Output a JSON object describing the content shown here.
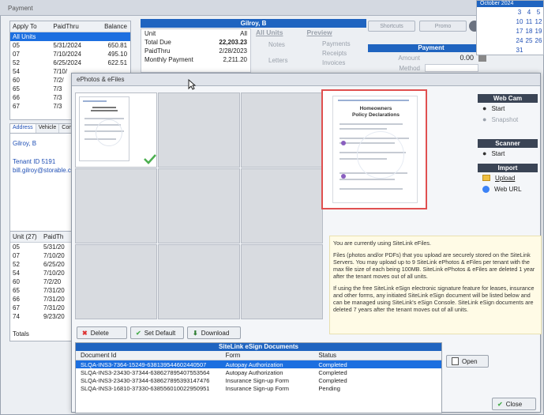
{
  "background": {
    "window_title": "Payment",
    "tenant_name": "Gilroy, B",
    "apply_grid": {
      "headers": [
        "Apply To",
        "PaidThru",
        "Balance"
      ],
      "rows": [
        {
          "unit": "All Units",
          "paid": "",
          "bal": ""
        },
        {
          "unit": "05",
          "paid": "5/31/2024",
          "bal": "650.81"
        },
        {
          "unit": "07",
          "paid": "7/10/2024",
          "bal": "495.10"
        },
        {
          "unit": "52",
          "paid": "6/25/2024",
          "bal": "622.51"
        },
        {
          "unit": "54",
          "paid": "7/10/",
          "bal": ""
        },
        {
          "unit": "60",
          "paid": "7/2/",
          "bal": ""
        },
        {
          "unit": "65",
          "paid": "7/3",
          "bal": ""
        },
        {
          "unit": "66",
          "paid": "7/3",
          "bal": ""
        },
        {
          "unit": "67",
          "paid": "7/3",
          "bal": ""
        }
      ]
    },
    "unit_info": {
      "unit_label": "Unit",
      "unit_value": "All",
      "total_due_label": "Total Due",
      "total_due_value": "22,203.23",
      "paid_thru_label": "PaidThru",
      "paid_thru_value": "2/28/2023",
      "monthly_label": "Monthly Payment",
      "monthly_value": "2,211.20"
    },
    "preview_panel": {
      "all_units": "All Units",
      "preview": "Preview",
      "notes": "Notes",
      "letters": "Letters",
      "payments": "Payments",
      "receipts": "Receipts",
      "invoices": "Invoices"
    },
    "top_buttons": {
      "shortcuts": "Shortcuts",
      "promo": "Promo"
    },
    "payment": {
      "title": "Payment",
      "amount_label": "Amount",
      "amount_value": "0.00",
      "method_label": "Method"
    },
    "calendar": {
      "title": "October 2024",
      "rows": [
        [
          "3",
          "4",
          "5"
        ],
        [
          "10",
          "11",
          "12"
        ],
        [
          "17",
          "18",
          "19"
        ],
        [
          "24",
          "25",
          "26"
        ],
        [
          "31",
          "",
          ""
        ]
      ]
    },
    "tenant_tabs": [
      "Address",
      "Vehicle",
      "Conta"
    ],
    "tenant_info": {
      "name": "Gilroy, B",
      "tenant_id": "Tenant ID  5191",
      "email": "bill.gilroy@storable.c"
    },
    "unit_grid": {
      "headers": [
        "Unit (27)",
        "PaidTh"
      ],
      "rows": [
        {
          "unit": "05",
          "paid": "5/31/20"
        },
        {
          "unit": "07",
          "paid": "7/10/20"
        },
        {
          "unit": "52",
          "paid": "6/25/20"
        },
        {
          "unit": "54",
          "paid": "7/10/20"
        },
        {
          "unit": "60",
          "paid": "7/2/20"
        },
        {
          "unit": "65",
          "paid": "7/31/20"
        },
        {
          "unit": "66",
          "paid": "7/31/20"
        },
        {
          "unit": "67",
          "paid": "7/31/20"
        },
        {
          "unit": "74",
          "paid": "9/23/20"
        }
      ],
      "totals_label": "Totals"
    }
  },
  "dialog": {
    "title": "ePhotos & eFiles",
    "thumbnail": {
      "title_line1": "Homeowners",
      "title_line2": "Policy Declarations"
    },
    "webcam": {
      "title": "Web Cam",
      "start": "Start",
      "snapshot": "Snapshot"
    },
    "scanner": {
      "title": "Scanner",
      "start": "Start"
    },
    "import": {
      "title": "Import",
      "upload": "Upload",
      "web_url": "Web URL"
    },
    "info_paragraphs": [
      "You are currently using SiteLink eFiles.",
      "Files (photos and/or PDFs) that you upload are securely stored on the SiteLink Servers. You may upload up to 9 SiteLink ePhotos & eFiles per tenant with the max file size of each being 100MB. SiteLink ePhotos & eFiles are deleted 1 year after the tenant moves out of all units.",
      "If using the free SiteLink eSign electronic signature feature for leases, insurance and other forms, any initiated SiteLink eSign document will be listed below and can be managed using SiteLink's eSign Console. SiteLink eSign documents are deleted 7 years after the tenant moves out of all units."
    ],
    "buttons": {
      "delete": "Delete",
      "set_default": "Set Default",
      "download": "Download",
      "open": "Open",
      "close": "Close"
    },
    "esign": {
      "title": "SiteLink eSign Documents",
      "headers": [
        "Document Id",
        "Form",
        "Status"
      ],
      "rows": [
        {
          "id": "SLQA-INS3-7364-15249-638139544602440507",
          "form": "Autopay Authorization",
          "status": "Completed"
        },
        {
          "id": "SLQA-INS3-23430-37344-638627895407553564",
          "form": "Autopay Authorization",
          "status": "Completed"
        },
        {
          "id": "SLQA-INS3-23430-37344-638627895393147476",
          "form": "Insurance Sign-up Form",
          "status": "Completed"
        },
        {
          "id": "SLQA-INS3-16810-37330-638556010022950951",
          "form": "Insurance Sign-up Form",
          "status": "Pending"
        }
      ]
    }
  },
  "colors": {
    "accent": "#1f64c0",
    "highlight": "#e05050",
    "selection": "#1c6fe0"
  }
}
